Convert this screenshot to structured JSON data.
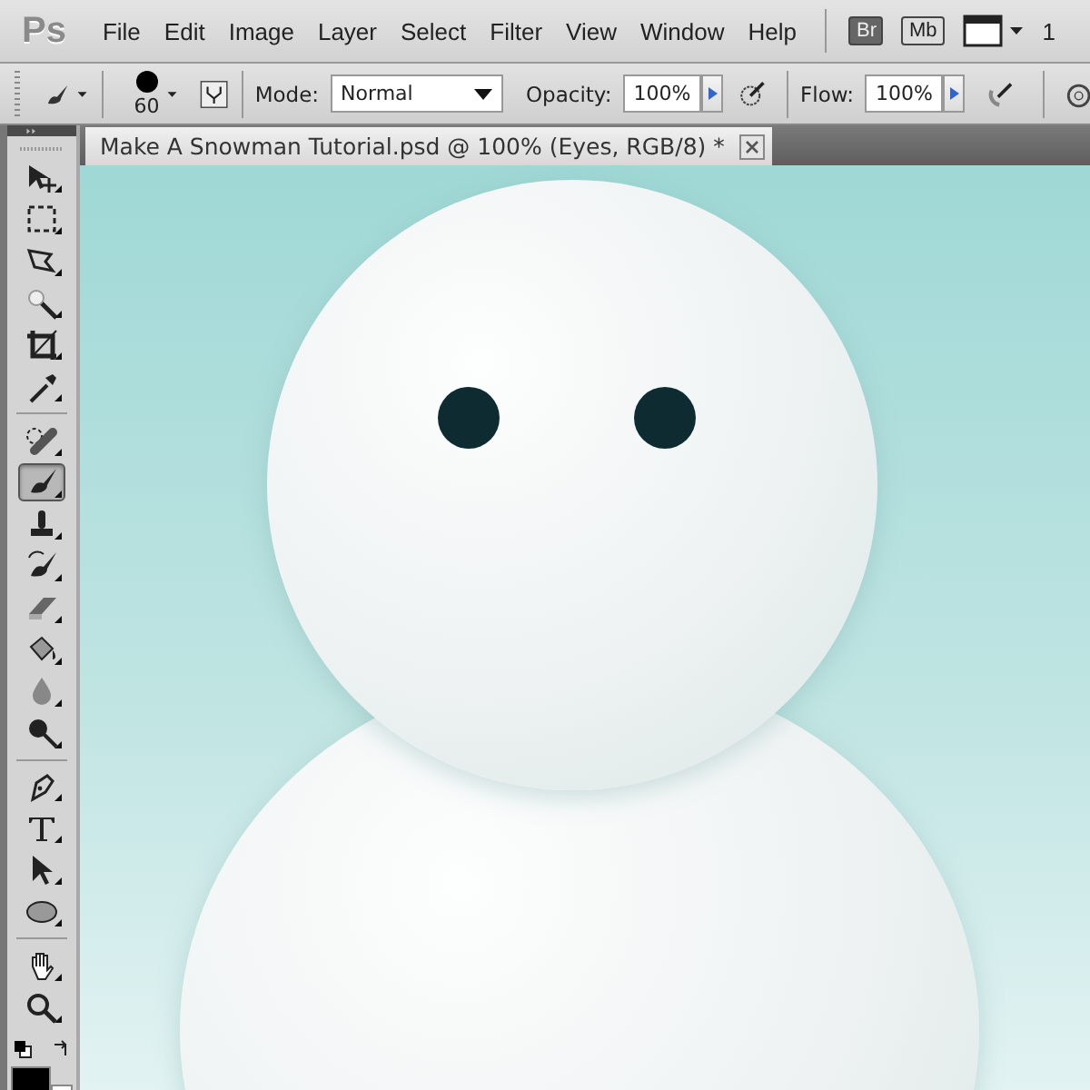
{
  "app": {
    "logo": "Ps"
  },
  "menu": [
    "File",
    "Edit",
    "Image",
    "Layer",
    "Select",
    "Filter",
    "View",
    "Window",
    "Help"
  ],
  "launchers": [
    {
      "kind": "bridge",
      "label": "Br"
    },
    {
      "kind": "minibridge",
      "label": "Mb"
    },
    {
      "kind": "screen"
    }
  ],
  "menu_overflow": "1",
  "options": {
    "brush_size": "60",
    "mode_label": "Mode:",
    "mode_value": "Normal",
    "opacity_label": "Opacity:",
    "opacity_value": "100%",
    "flow_label": "Flow:",
    "flow_value": "100%"
  },
  "document_tab": {
    "title": "Make A Snowman Tutorial.psd @ 100% (Eyes, RGB/8) *",
    "selected": true
  },
  "tool_groups": [
    [
      {
        "kind": "move",
        "selected": false
      },
      {
        "kind": "marquee",
        "selected": false
      },
      {
        "kind": "lasso",
        "selected": false
      },
      {
        "kind": "wand",
        "selected": false
      },
      {
        "kind": "crop",
        "selected": false
      },
      {
        "kind": "eyedropper",
        "selected": false
      }
    ],
    [
      {
        "kind": "healing",
        "selected": false
      },
      {
        "kind": "brush",
        "selected": true
      },
      {
        "kind": "stamp",
        "selected": false
      },
      {
        "kind": "history",
        "selected": false
      },
      {
        "kind": "eraser",
        "selected": false
      },
      {
        "kind": "bucket",
        "selected": false
      },
      {
        "kind": "blur",
        "selected": false
      },
      {
        "kind": "dodge",
        "selected": false
      }
    ],
    [
      {
        "kind": "pen",
        "selected": false
      },
      {
        "kind": "type",
        "selected": false
      },
      {
        "kind": "path",
        "selected": false
      },
      {
        "kind": "ellipse",
        "selected": false
      }
    ],
    [
      {
        "kind": "hand",
        "selected": false
      },
      {
        "kind": "zoom",
        "selected": false
      }
    ]
  ]
}
